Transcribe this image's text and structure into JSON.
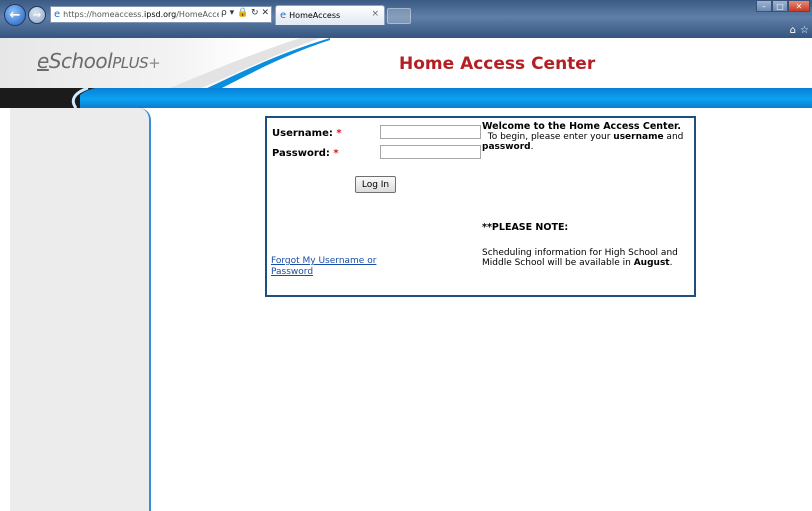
{
  "browser": {
    "address": {
      "host_dim": "https://homeaccess.",
      "host_bold": "ipsd.org",
      "path": "/HomeAccess/default.a"
    },
    "address_icons": "ρ ▾ 🔒 ↻ ✕",
    "tab_title": "HomeAccess",
    "tab_close": "×",
    "icons": {
      "back": "←",
      "forward": "→",
      "site": "e",
      "home": "⌂",
      "favorites": "☆",
      "minimize": "–",
      "maximize": "□",
      "close": "✕"
    }
  },
  "header": {
    "logo": {
      "e": "e",
      "name": "School",
      "suffix": "PLUS",
      "plus": "+"
    },
    "title": "Home Access Center"
  },
  "login": {
    "username_label": "Username:",
    "password_label": "Password:",
    "required_mark": "*",
    "username_value": "",
    "password_value": "",
    "login_button": "Log In",
    "forgot_link": "Forgot My Username or Password"
  },
  "welcome": {
    "title": "Welcome to the Home Access Center.",
    "text_1": "To begin, please enter your ",
    "bold_1": "username",
    "text_2": " and ",
    "bold_2": "password",
    "text_3": "."
  },
  "note": {
    "heading": "**PLEASE NOTE:",
    "text": "Scheduling information for High School and Middle School will be available in ",
    "bold": "August",
    "end": "."
  },
  "colors": {
    "title_red": "#b51e23",
    "band_blue": "#0aa2f0",
    "box_border": "#1f4f7f",
    "link_blue": "#1a4ea8"
  }
}
